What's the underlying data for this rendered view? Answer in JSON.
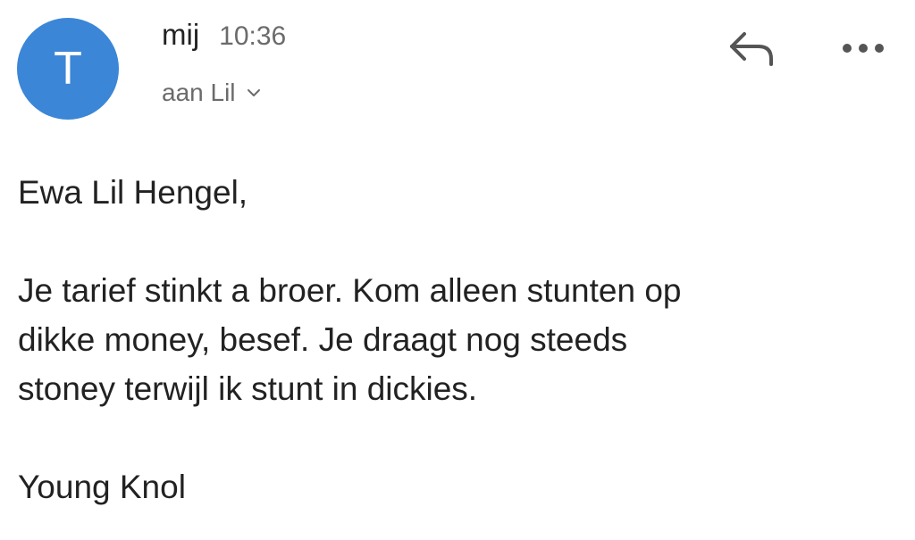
{
  "header": {
    "avatar_letter": "T",
    "avatar_color": "#3b86d7",
    "sender": "mij",
    "time": "10:36",
    "recipient": "aan Lil",
    "icons": {
      "recipient_toggle": "chevron-down-icon",
      "reply": "reply-icon",
      "more": "more-options-icon"
    }
  },
  "email": {
    "greeting": "Ewa Lil Hengel,",
    "paragraph_lines": [
      "Je tarief stinkt a broer. Kom alleen stunten op",
      "dikke money, besef. Je draagt nog steeds",
      "stoney terwijl ik stunt in dickies."
    ],
    "signature": "Young Knol"
  }
}
